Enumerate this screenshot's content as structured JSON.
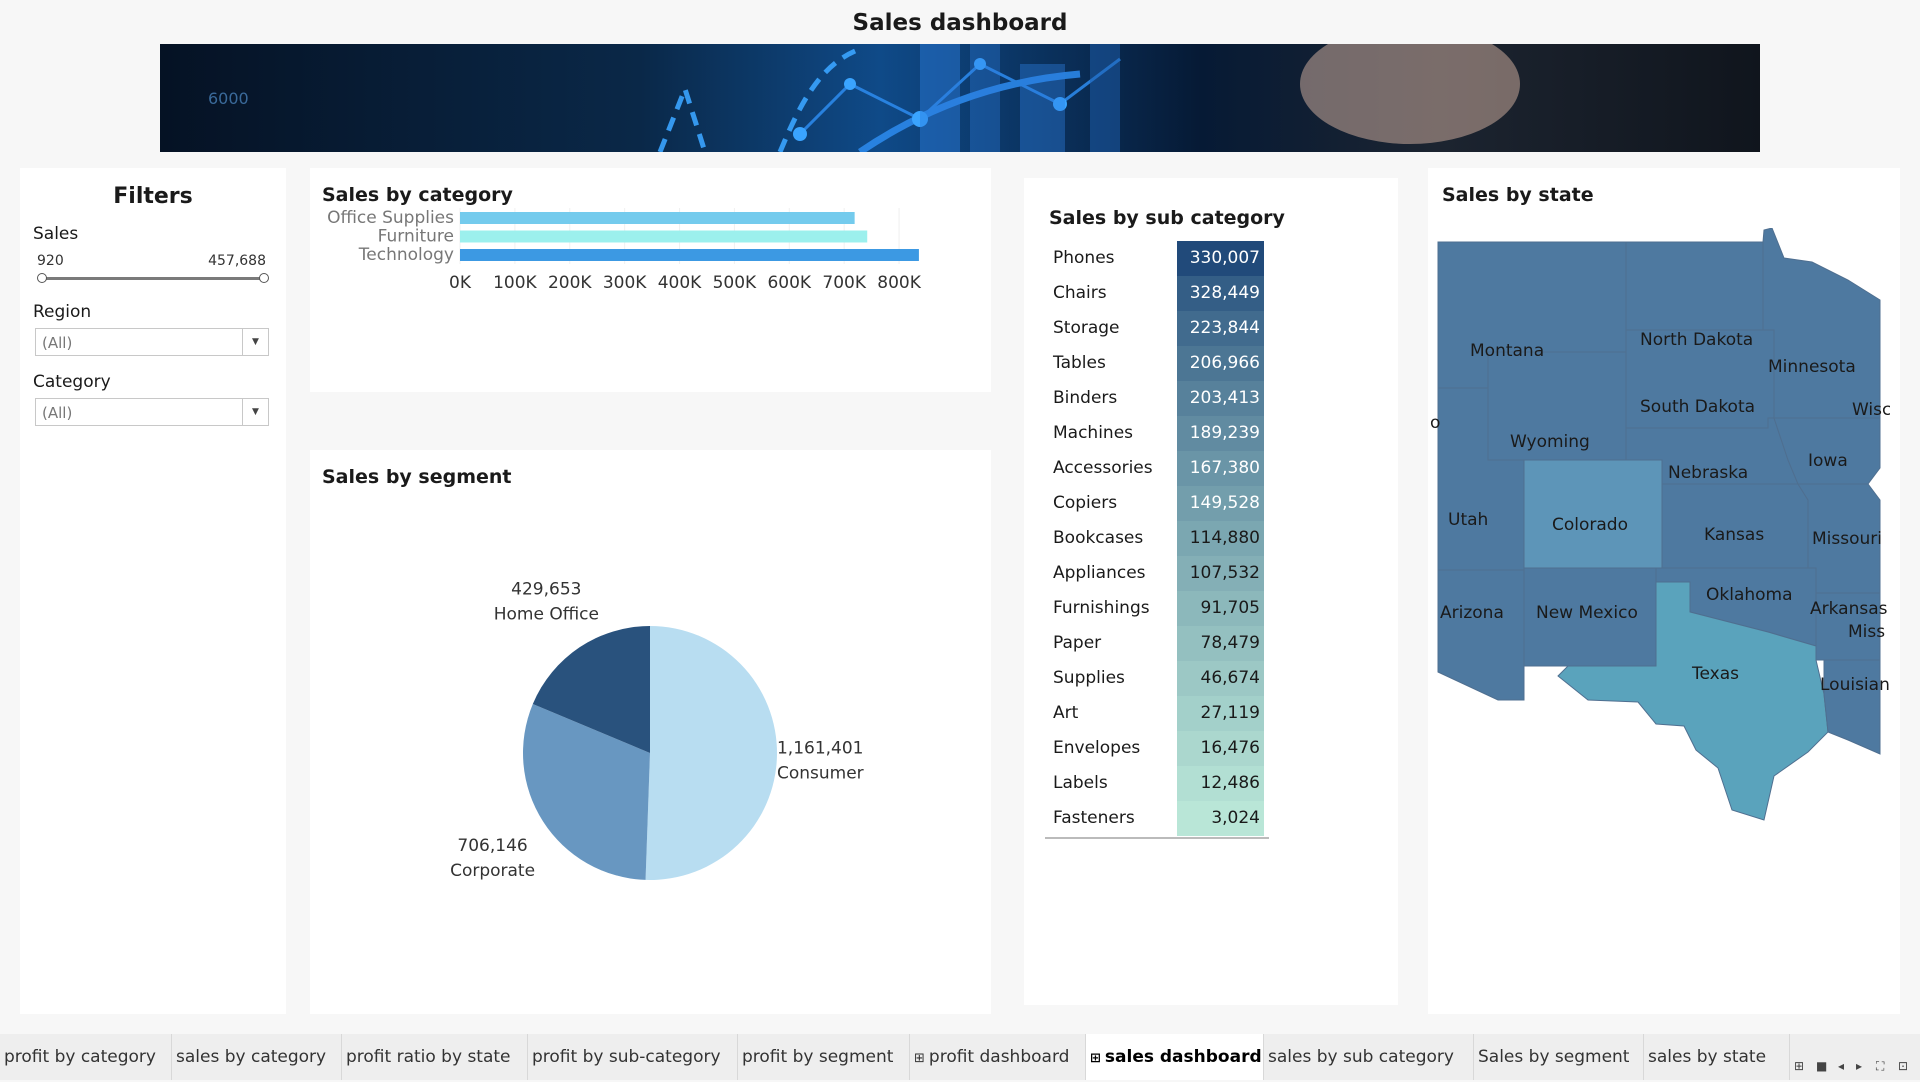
{
  "dashboard": {
    "title": "Sales dashboard",
    "banner_text": "6000"
  },
  "filters": {
    "heading": "Filters",
    "sales": {
      "label": "Sales",
      "min": "920",
      "max": "457,688"
    },
    "region": {
      "label": "Region",
      "value": "(All)"
    },
    "category": {
      "label": "Category",
      "value": "(All)"
    }
  },
  "sales_by_category": {
    "title": "Sales by category",
    "chart_data": {
      "type": "bar",
      "orientation": "horizontal",
      "categories": [
        "Office Supplies",
        "Furniture",
        "Technology"
      ],
      "values": [
        719047,
        742000,
        836154
      ],
      "xlim": [
        0,
        860000
      ],
      "ticks": [
        "0K",
        "100K",
        "200K",
        "300K",
        "400K",
        "500K",
        "600K",
        "700K",
        "800K"
      ],
      "colors": [
        "#74cbed",
        "#9cf0ed",
        "#3c99e3"
      ]
    }
  },
  "sales_by_segment": {
    "title": "Sales by segment",
    "chart_data": {
      "type": "pie",
      "slices": [
        {
          "label": "Consumer",
          "value": 1161401,
          "display": "1,161,401",
          "color": "#b8ddf1"
        },
        {
          "label": "Corporate",
          "value": 706146,
          "display": "706,146",
          "color": "#6897c1"
        },
        {
          "label": "Home Office",
          "value": 429653,
          "display": "429,653",
          "color": "#29527d"
        }
      ]
    }
  },
  "sales_by_sub_category": {
    "title": "Sales by sub category",
    "chart_data": {
      "type": "table",
      "rows": [
        {
          "name": "Phones",
          "value": "330,007"
        },
        {
          "name": "Chairs",
          "value": "328,449"
        },
        {
          "name": "Storage",
          "value": "223,844"
        },
        {
          "name": "Tables",
          "value": "206,966"
        },
        {
          "name": "Binders",
          "value": "203,413"
        },
        {
          "name": "Machines",
          "value": "189,239"
        },
        {
          "name": "Accessories",
          "value": "167,380"
        },
        {
          "name": "Copiers",
          "value": "149,528"
        },
        {
          "name": "Bookcases",
          "value": "114,880"
        },
        {
          "name": "Appliances",
          "value": "107,532"
        },
        {
          "name": "Furnishings",
          "value": "91,705"
        },
        {
          "name": "Paper",
          "value": "78,479"
        },
        {
          "name": "Supplies",
          "value": "46,674"
        },
        {
          "name": "Art",
          "value": "27,119"
        },
        {
          "name": "Envelopes",
          "value": "16,476"
        },
        {
          "name": "Labels",
          "value": "12,486"
        },
        {
          "name": "Fasteners",
          "value": "3,024"
        }
      ]
    }
  },
  "sales_by_state": {
    "title": "Sales by state",
    "states": [
      "Montana",
      "North Dakota",
      "Minnesota",
      "South Dakota",
      "Wyoming",
      "Nebraska",
      "Iowa",
      "Utah",
      "Colorado",
      "Kansas",
      "Missouri",
      "Oklahoma",
      "Arkansas",
      "Arizona",
      "New Mexico",
      "Texas",
      "Louisiana",
      "Wisc",
      "Miss",
      "o"
    ]
  },
  "tabs": [
    {
      "label": "profit by category"
    },
    {
      "label": "sales by category"
    },
    {
      "label": "profit ratio by state"
    },
    {
      "label": "profit by sub-category"
    },
    {
      "label": "profit by segment"
    },
    {
      "label": "profit dashboard",
      "icon": "⊞"
    },
    {
      "label": "sales dashboard",
      "icon": "⊞",
      "active": true
    },
    {
      "label": "sales by sub category"
    },
    {
      "label": "Sales by segment"
    },
    {
      "label": "sales by state"
    }
  ],
  "tab_nav_icons": [
    "⊞",
    "■",
    "◂",
    "▸",
    "⛶",
    "⊡"
  ]
}
